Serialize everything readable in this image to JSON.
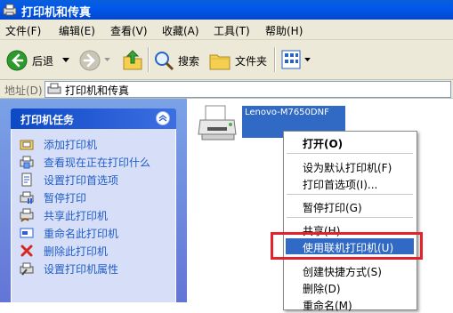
{
  "window": {
    "title": "打印机和传真"
  },
  "menubar": [
    "文件(F)",
    "编辑(E)",
    "查看(V)",
    "收藏(A)",
    "工具(T)",
    "帮助(H)"
  ],
  "toolbar": {
    "back": "后退",
    "search": "搜索",
    "folders": "文件夹"
  },
  "address": {
    "label": "地址(D)",
    "value": "打印机和传真"
  },
  "tasks": {
    "header": "打印机任务",
    "items": [
      "添加打印机",
      "查看现在正在打印什么",
      "设置打印首选项",
      "暂停打印",
      "共享此打印机",
      "重命名此打印机",
      "删除此打印机",
      "设置打印机属性"
    ]
  },
  "printer": {
    "name": "Lenovo-M7650DNF"
  },
  "context_menu": {
    "items": [
      "打开(O)",
      "设为默认打印机(F)",
      "打印首选项(I)...",
      "暂停打印(G)",
      "共享(H)...",
      "使用联机打印机(U)",
      "创建快捷方式(S)",
      "删除(D)",
      "重命名(M)"
    ],
    "highlighted": "使用联机打印机(U)"
  },
  "colors": {
    "titlebar": "#0058ee",
    "selection": "#316ac5",
    "annotation": "#e3222b",
    "taskpane": "#6375d6"
  }
}
